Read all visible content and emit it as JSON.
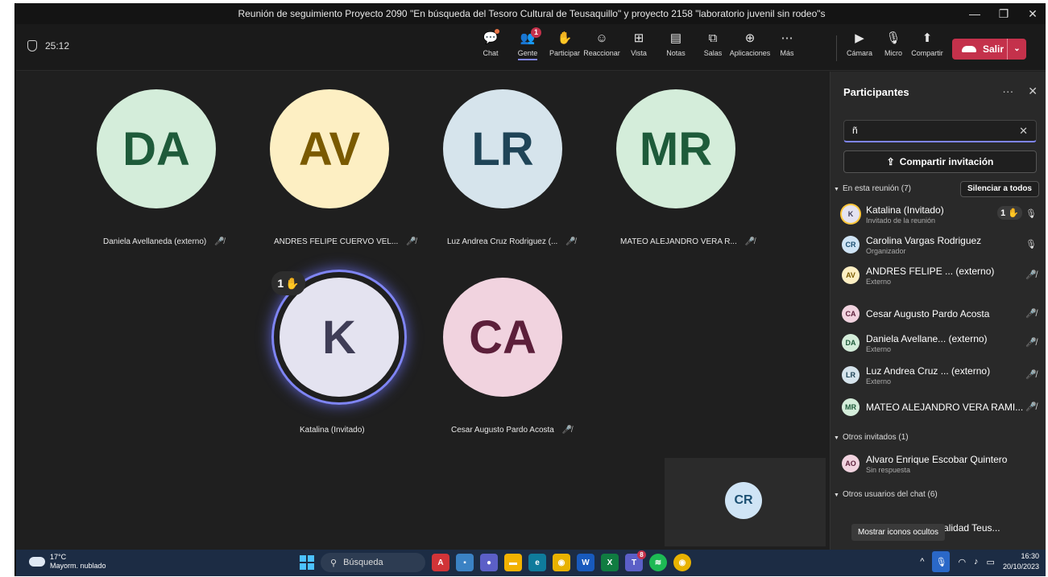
{
  "window": {
    "title": "Reunión de seguimiento Proyecto 2090 \"En búsqueda del Tesoro Cultural de Teusaquillo\" y proyecto 2158 \"laboratorio juvenil sin rodeo\"s"
  },
  "toolbar": {
    "timer": "25:12",
    "tools": [
      {
        "label": "Chat",
        "icon": "chat-icon"
      },
      {
        "label": "Gente",
        "icon": "people-icon",
        "badge": "1"
      },
      {
        "label": "Participar",
        "icon": "raise-hand-icon"
      },
      {
        "label": "Reaccionar",
        "icon": "smile-icon"
      },
      {
        "label": "Vista",
        "icon": "grid-icon"
      },
      {
        "label": "Notas",
        "icon": "notes-icon"
      },
      {
        "label": "Salas",
        "icon": "rooms-icon"
      },
      {
        "label": "Aplicaciones",
        "icon": "plus-icon"
      },
      {
        "label": "Más",
        "icon": "more-icon"
      }
    ],
    "media": [
      {
        "label": "Cámara",
        "icon": "camera-off-icon"
      },
      {
        "label": "Micro",
        "icon": "mic-icon"
      },
      {
        "label": "Compartir",
        "icon": "share-icon"
      }
    ],
    "leave_label": "Salir"
  },
  "stage": {
    "tiles": [
      {
        "initials": "DA",
        "name": "Daniela Avellaneda (externo)",
        "bg": "#d4edda",
        "fg": "#1e5b3a"
      },
      {
        "initials": "AV",
        "name": "ANDRES FELIPE CUERVO VEL...",
        "bg": "#fdefc3",
        "fg": "#7a5a00"
      },
      {
        "initials": "LR",
        "name": "Luz Andrea Cruz Rodriguez (...",
        "bg": "#d6e4ec",
        "fg": "#1f4457"
      },
      {
        "initials": "MR",
        "name": "MATEO ALEJANDRO VERA R...",
        "bg": "#d4edda",
        "fg": "#1e5b3a"
      },
      {
        "initials": "K",
        "name": "Katalina (Invitado)",
        "bg": "#e4e3f0",
        "fg": "#3f3d56",
        "hand": "1"
      },
      {
        "initials": "CA",
        "name": "Cesar Augusto Pardo Acosta",
        "bg": "#f1d3df",
        "fg": "#5c1f3a"
      }
    ],
    "self_initials": "CR"
  },
  "panel": {
    "title": "Participantes",
    "search_value": "ñ",
    "invite_label": "Compartir invitación",
    "in_meeting_label": "En esta reunión (7)",
    "mute_all_label": "Silenciar a todos",
    "participants": [
      {
        "initials": "K",
        "name": "Katalina (Invitado)",
        "role": "Invitado de la reunión",
        "bg": "#e4e3f0",
        "fg": "#3f3d56",
        "hand": "1",
        "mic": "on"
      },
      {
        "initials": "CR",
        "name": "Carolina Vargas Rodriguez",
        "role": "Organizador",
        "bg": "#cfe4f5",
        "fg": "#1b4f72",
        "mic": "on"
      },
      {
        "initials": "AV",
        "name": "ANDRES FELIPE ... (externo)",
        "role": "Externo",
        "bg": "#fdefc3",
        "fg": "#7a5a00",
        "mic": "off"
      },
      {
        "initials": "CA",
        "name": "Cesar Augusto Pardo Acosta",
        "role": "",
        "bg": "#f1d3df",
        "fg": "#5c1f3a",
        "mic": "off"
      },
      {
        "initials": "DA",
        "name": "Daniela Avellane... (externo)",
        "role": "Externo",
        "bg": "#d4edda",
        "fg": "#1e5b3a",
        "mic": "off"
      },
      {
        "initials": "LR",
        "name": "Luz Andrea Cruz ... (externo)",
        "role": "Externo",
        "bg": "#d6e4ec",
        "fg": "#1f4457",
        "mic": "off"
      },
      {
        "initials": "MR",
        "name": "MATEO ALEJANDRO VERA RAMI...",
        "role": "",
        "bg": "#d4edda",
        "fg": "#1e5b3a",
        "mic": "off"
      }
    ],
    "others_label": "Otros invitados (1)",
    "others": [
      {
        "initials": "AO",
        "name": "Alvaro Enrique Escobar Quintero",
        "role": "Sin respuesta",
        "bg": "#f1d3df",
        "fg": "#5c1f3a"
      }
    ],
    "chat_users_label": "Otros usuarios del chat (6)",
    "chat_user_partial": "ud Localidad Teus...",
    "tooltip": "Mostrar iconos ocultos"
  },
  "taskbar": {
    "temp": "17°C",
    "weather": "Mayorm. nublado",
    "search_label": "Búsqueda",
    "teams_badge": "8",
    "time": "16:30",
    "date": "20/10/2023"
  }
}
